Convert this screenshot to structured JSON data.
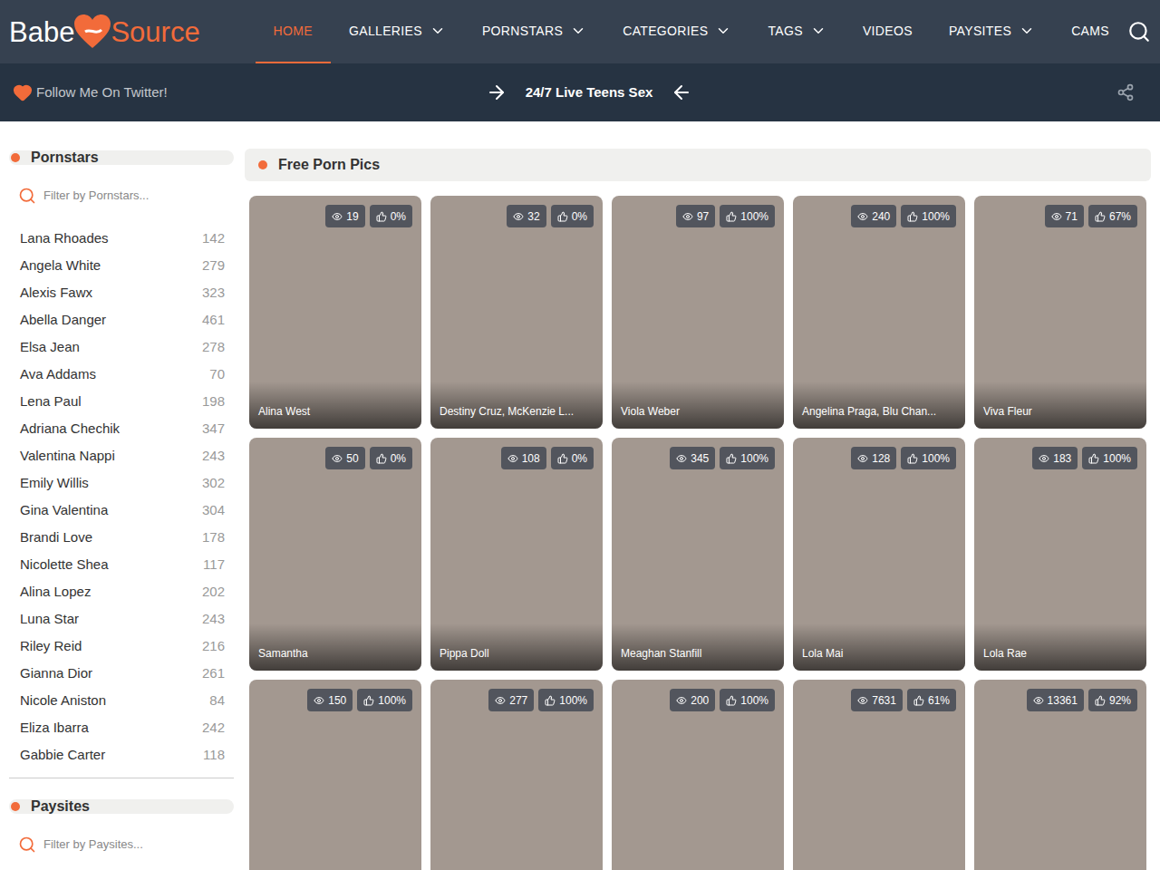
{
  "logo": {
    "left": "Babe",
    "right": "Source"
  },
  "nav": [
    {
      "label": "HOME",
      "dropdown": false,
      "selected": true
    },
    {
      "label": "GALLERIES",
      "dropdown": true,
      "selected": false
    },
    {
      "label": "PORNSTARS",
      "dropdown": true,
      "selected": false
    },
    {
      "label": "CATEGORIES",
      "dropdown": true,
      "selected": false
    },
    {
      "label": "TAGS",
      "dropdown": true,
      "selected": false
    },
    {
      "label": "VIDEOS",
      "dropdown": false,
      "selected": false
    },
    {
      "label": "PAYSITES",
      "dropdown": true,
      "selected": false
    },
    {
      "label": "CAMS",
      "dropdown": false,
      "selected": false
    }
  ],
  "subbar": {
    "follow": "Follow Me On Twitter!",
    "promo": "24/7 Live Teens Sex"
  },
  "sidebar": {
    "pornstars": {
      "title": "Pornstars",
      "placeholder": "Filter by Pornstars...",
      "items": [
        {
          "name": "Lana Rhoades",
          "count": "142"
        },
        {
          "name": "Angela White",
          "count": "279"
        },
        {
          "name": "Alexis Fawx",
          "count": "323"
        },
        {
          "name": "Abella Danger",
          "count": "461"
        },
        {
          "name": "Elsa Jean",
          "count": "278"
        },
        {
          "name": "Ava Addams",
          "count": "70"
        },
        {
          "name": "Lena Paul",
          "count": "198"
        },
        {
          "name": "Adriana Chechik",
          "count": "347"
        },
        {
          "name": "Valentina Nappi",
          "count": "243"
        },
        {
          "name": "Emily Willis",
          "count": "302"
        },
        {
          "name": "Gina Valentina",
          "count": "304"
        },
        {
          "name": "Brandi Love",
          "count": "178"
        },
        {
          "name": "Nicolette Shea",
          "count": "117"
        },
        {
          "name": "Alina Lopez",
          "count": "202"
        },
        {
          "name": "Luna Star",
          "count": "243"
        },
        {
          "name": "Riley Reid",
          "count": "216"
        },
        {
          "name": "Gianna Dior",
          "count": "261"
        },
        {
          "name": "Nicole Aniston",
          "count": "84"
        },
        {
          "name": "Eliza Ibarra",
          "count": "242"
        },
        {
          "name": "Gabbie Carter",
          "count": "118"
        }
      ]
    },
    "paysites": {
      "title": "Paysites",
      "placeholder": "Filter by Paysites..."
    }
  },
  "main": {
    "title": "Free Porn Pics",
    "cards": [
      {
        "name": "Alina West",
        "views": "19",
        "likes": "0%"
      },
      {
        "name": "Destiny Cruz, McKenzie L...",
        "views": "32",
        "likes": "0%"
      },
      {
        "name": "Viola Weber",
        "views": "97",
        "likes": "100%"
      },
      {
        "name": "Angelina Praga, Blu Chan...",
        "views": "240",
        "likes": "100%"
      },
      {
        "name": "Viva Fleur",
        "views": "71",
        "likes": "67%"
      },
      {
        "name": "Samantha",
        "views": "50",
        "likes": "0%"
      },
      {
        "name": "Pippa Doll",
        "views": "108",
        "likes": "0%"
      },
      {
        "name": "Meaghan Stanfill",
        "views": "345",
        "likes": "100%"
      },
      {
        "name": "Lola Mai",
        "views": "128",
        "likes": "100%"
      },
      {
        "name": "Lola Rae",
        "views": "183",
        "likes": "100%"
      },
      {
        "name": "",
        "views": "150",
        "likes": "100%"
      },
      {
        "name": "",
        "views": "277",
        "likes": "100%"
      },
      {
        "name": "",
        "views": "200",
        "likes": "100%"
      },
      {
        "name": "",
        "views": "7631",
        "likes": "61%"
      },
      {
        "name": "",
        "views": "13361",
        "likes": "92%"
      }
    ]
  }
}
